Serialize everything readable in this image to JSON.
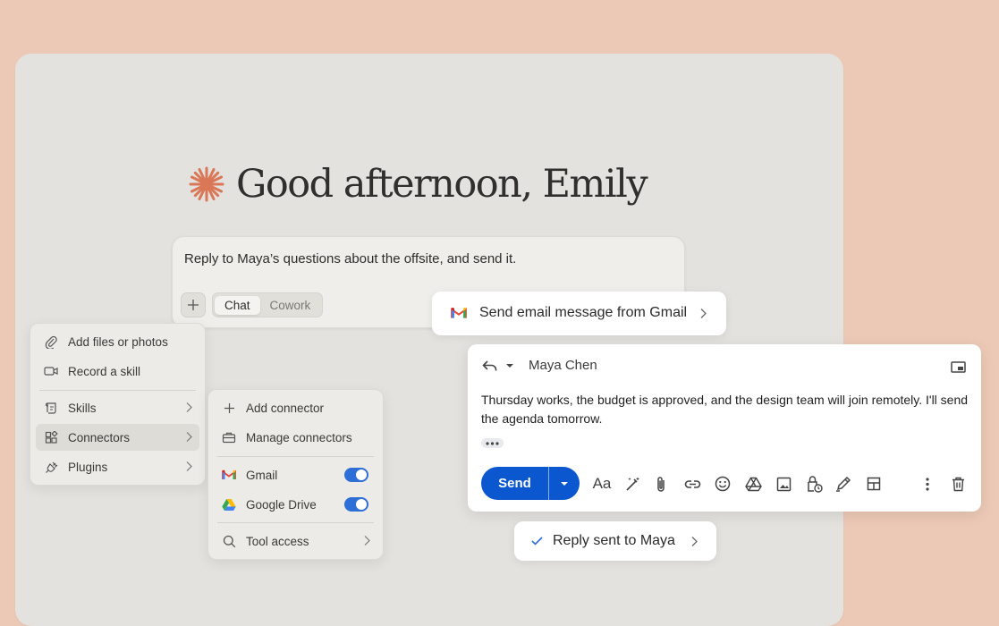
{
  "greeting": {
    "text": "Good afternoon, Emily"
  },
  "prompt": {
    "text": "Reply to Maya’s questions about the offsite, and send it.",
    "modes": [
      "Chat",
      "Cowork"
    ],
    "active_mode": "Chat"
  },
  "attach_menu": {
    "items": [
      {
        "label": "Add files or photos",
        "icon": "paperclip-icon"
      },
      {
        "label": "Record a skill",
        "icon": "video-icon"
      },
      {
        "label": "Skills",
        "icon": "skills-icon"
      },
      {
        "label": "Connectors",
        "icon": "connectors-icon"
      },
      {
        "label": "Plugins",
        "icon": "plug-icon"
      }
    ]
  },
  "connectors_menu": {
    "items": [
      {
        "label": "Add connector",
        "icon": "plus-icon"
      },
      {
        "label": "Manage connectors",
        "icon": "briefcase-icon"
      },
      {
        "label": "Gmail",
        "icon": "gmail-icon",
        "enabled": true
      },
      {
        "label": "Google Drive",
        "icon": "google-drive-icon",
        "enabled": true
      },
      {
        "label": "Tool access",
        "icon": "search-icon"
      }
    ]
  },
  "tool_call": {
    "label": "Send email message from Gmail"
  },
  "email": {
    "to": "Maya Chen",
    "body": "Thursday works, the budget is approved, and the design team will join remotely. I'll send the agenda tomorrow.",
    "send_label": "Send",
    "format_label": "Aa"
  },
  "result": {
    "label": "Reply sent to Maya"
  },
  "colors": {
    "background": "#ecc9b6",
    "accent_star": "#d97757",
    "gmail_send": "#0b57d0",
    "toggle_on": "#2d6fd6"
  }
}
